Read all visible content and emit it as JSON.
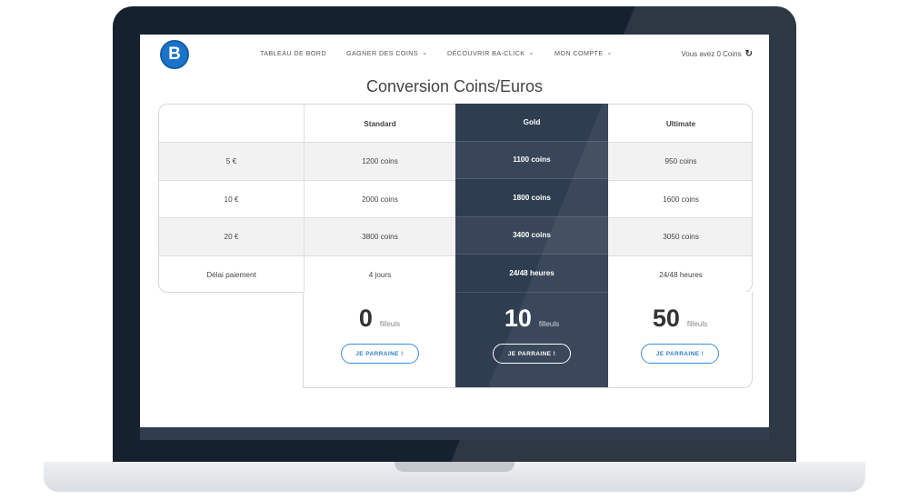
{
  "header": {
    "logo_letter": "B",
    "nav": [
      {
        "label": "TABLEAU DE BORD",
        "dropdown": false
      },
      {
        "label": "GAGNER DES COINS",
        "dropdown": true
      },
      {
        "label": "DÉCOUVRIR BA-CLICK",
        "dropdown": true
      },
      {
        "label": "MON COMPTE",
        "dropdown": true
      }
    ],
    "balance": "Vous avez 0 Coins",
    "refresh_icon": "↻"
  },
  "page_title": "Conversion Coins/Euros",
  "table": {
    "columns": [
      "",
      "Standard",
      "Gold",
      "Ultimate"
    ],
    "rows": [
      {
        "label": "5 €",
        "standard": "1200 coins",
        "gold": "1100 coins",
        "ultimate": "950 coins"
      },
      {
        "label": "10 €",
        "standard": "2000 coins",
        "gold": "1800 coins",
        "ultimate": "1600 coins"
      },
      {
        "label": "20 €",
        "standard": "3800 coins",
        "gold": "3400 coins",
        "ultimate": "3050 coins"
      },
      {
        "label": "Délai paiement",
        "standard": "4 jours",
        "gold": "24/48 heures",
        "ultimate": "24/48 heures"
      }
    ],
    "filleuls_label": "filleuls",
    "plans": [
      {
        "name": "Standard",
        "count": "0",
        "button": "JE PARRAINE !"
      },
      {
        "name": "Gold",
        "count": "10",
        "button": "JE PARRAINE !"
      },
      {
        "name": "Ultimate",
        "count": "50",
        "button": "JE PARRAINE !"
      }
    ]
  },
  "colors": {
    "brand_blue": "#1a73c9",
    "gold_column": "#2f3d51",
    "laptop_frame": "#15212f"
  },
  "icons": {
    "dropdown": "chevron-down-icon",
    "refresh": "refresh-icon"
  }
}
